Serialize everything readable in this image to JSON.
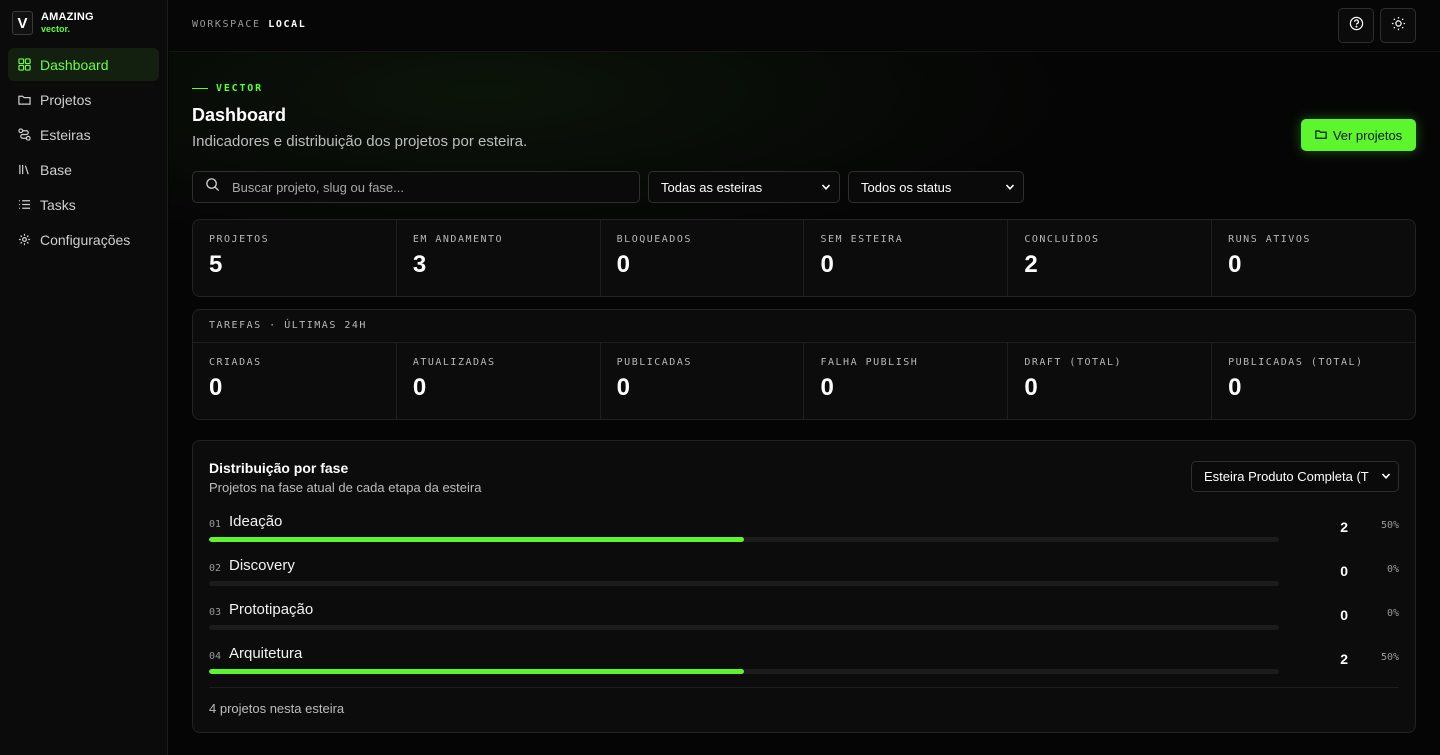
{
  "brand": {
    "logo": "V",
    "name": "AMAZING",
    "sub": "vector."
  },
  "sidebar": {
    "items": [
      {
        "label": "Dashboard",
        "icon": "grid-icon",
        "active": true
      },
      {
        "label": "Projetos",
        "icon": "folder-icon"
      },
      {
        "label": "Esteiras",
        "icon": "route-icon"
      },
      {
        "label": "Base",
        "icon": "library-icon"
      },
      {
        "label": "Tasks",
        "icon": "list-icon"
      },
      {
        "label": "Configurações",
        "icon": "gear-icon"
      }
    ]
  },
  "topbar": {
    "workspace_label": "WORKSPACE",
    "workspace_value": "LOCAL"
  },
  "header": {
    "eyebrow": "VECTOR",
    "title": "Dashboard",
    "subtitle": "Indicadores e distribuição dos projetos por esteira.",
    "cta_label": "Ver projetos"
  },
  "filters": {
    "search_placeholder": "Buscar projeto, slug ou fase...",
    "pipeline_select": "Todas as esteiras",
    "status_select": "Todos os status"
  },
  "stats": [
    {
      "label": "PROJETOS",
      "value": "5"
    },
    {
      "label": "EM ANDAMENTO",
      "value": "3"
    },
    {
      "label": "BLOQUEADOS",
      "value": "0"
    },
    {
      "label": "SEM ESTEIRA",
      "value": "0"
    },
    {
      "label": "CONCLUÍDOS",
      "value": "2"
    },
    {
      "label": "RUNS ATIVOS",
      "value": "0"
    }
  ],
  "tasks": {
    "heading": "TAREFAS · ÚLTIMAS 24H",
    "stats": [
      {
        "label": "CRIADAS",
        "value": "0"
      },
      {
        "label": "ATUALIZADAS",
        "value": "0"
      },
      {
        "label": "PUBLICADAS",
        "value": "0"
      },
      {
        "label": "FALHA PUBLISH",
        "value": "0"
      },
      {
        "label": "DRAFT (TOTAL)",
        "value": "0"
      },
      {
        "label": "PUBLICADAS (TOTAL)",
        "value": "0"
      }
    ]
  },
  "distribution": {
    "title": "Distribuição por fase",
    "subtitle": "Projetos na fase atual de cada etapa da esteira",
    "select": "Esteira Produto Completa (T",
    "phases": [
      {
        "num": "01",
        "name": "Ideação",
        "count": "2",
        "pct": "50%",
        "fraction": 0.5
      },
      {
        "num": "02",
        "name": "Discovery",
        "count": "0",
        "pct": "0%",
        "fraction": 0
      },
      {
        "num": "03",
        "name": "Prototipação",
        "count": "0",
        "pct": "0%",
        "fraction": 0
      },
      {
        "num": "04",
        "name": "Arquitetura",
        "count": "2",
        "pct": "50%",
        "fraction": 0.5
      }
    ],
    "footer": "4 projetos nesta esteira"
  },
  "colors": {
    "accent": "#5cf52e",
    "background": "#050505",
    "panel": "#0c0c0c"
  }
}
